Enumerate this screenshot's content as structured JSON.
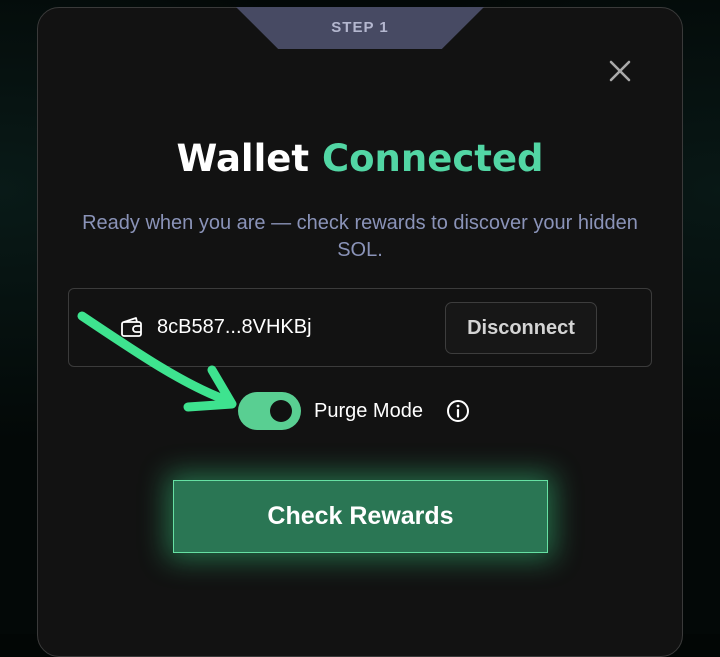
{
  "step": {
    "label": "STEP 1"
  },
  "dialog": {
    "title_part1": "Wallet",
    "title_part2": "Connected",
    "subtitle": "Ready when you are — check rewards to discover your hidden SOL.",
    "close_icon": "close-icon"
  },
  "wallet": {
    "icon": "wallet-icon",
    "address": "8cB587...8VHKBj",
    "disconnect_label": "Disconnect"
  },
  "purge_mode": {
    "label": "Purge Mode",
    "enabled": true,
    "info_icon": "info-icon"
  },
  "primary_action": {
    "label": "Check Rewards"
  },
  "colors": {
    "accent": "#52d6a4",
    "button_fill": "#2a7654",
    "toggle_on": "#59cf92",
    "tab": "#474a63",
    "subtitle": "#8a93b8",
    "annotation_arrow": "#3ee38f"
  }
}
